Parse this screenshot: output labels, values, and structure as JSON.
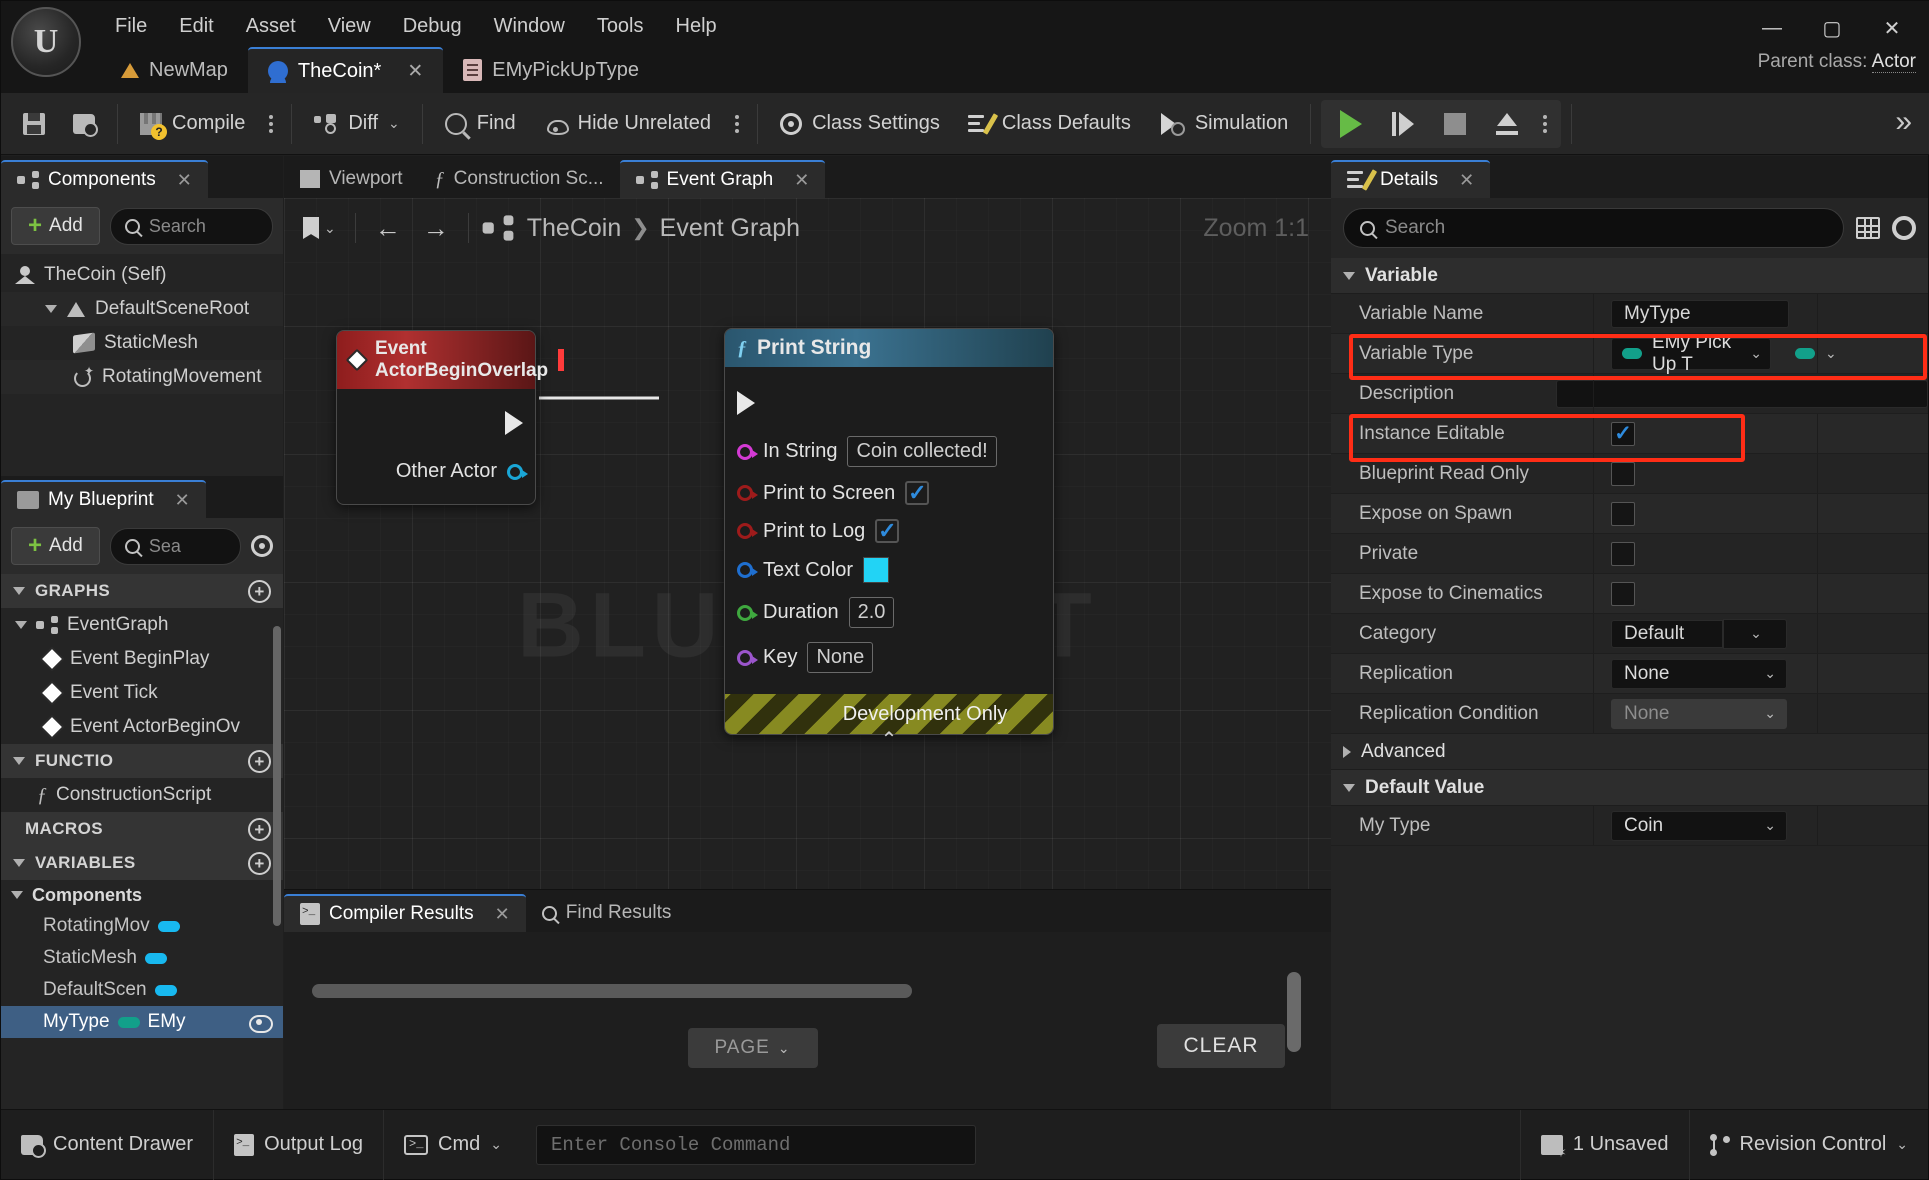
{
  "window": {
    "minimize": "—",
    "maximize": "▢",
    "close": "✕",
    "parent_class_label": "Parent class:",
    "parent_class_value": "Actor"
  },
  "menubar": [
    "File",
    "Edit",
    "Asset",
    "View",
    "Debug",
    "Window",
    "Tools",
    "Help"
  ],
  "asset_tabs": [
    {
      "label": "NewMap",
      "icon": "map-icon",
      "active": false,
      "closable": false
    },
    {
      "label": "TheCoin*",
      "icon": "blueprint-icon",
      "active": true,
      "closable": true,
      "close": "✕"
    },
    {
      "label": "EMyPickUpType",
      "icon": "enum-icon",
      "active": false,
      "closable": false
    }
  ],
  "toolbar": {
    "save": "Save",
    "browse": "Browse",
    "compile": "Compile",
    "diff": "Diff",
    "find": "Find",
    "hide_unrelated": "Hide Unrelated",
    "class_settings": "Class Settings",
    "class_defaults": "Class Defaults",
    "simulation": "Simulation",
    "play": "Play",
    "step": "Step",
    "stop": "Stop",
    "eject": "Eject",
    "expand": "»"
  },
  "components_panel": {
    "tab_label": "Components",
    "tab_close": "✕",
    "add_label": "Add",
    "add_plus": "+",
    "search_placeholder": "Search",
    "tree": [
      {
        "label": "TheCoin (Self)",
        "icon": "actor-icon",
        "indent": 0,
        "expander": "none"
      },
      {
        "label": "DefaultSceneRoot",
        "icon": "scene-root-icon",
        "indent": 1,
        "expander": "down"
      },
      {
        "label": "StaticMesh",
        "icon": "static-mesh-icon",
        "indent": 2,
        "expander": "none"
      },
      {
        "label": "RotatingMovement",
        "icon": "rotating-movement-icon",
        "indent": 2,
        "expander": "none"
      }
    ]
  },
  "my_blueprint_panel": {
    "tab_label": "My Blueprint",
    "tab_close": "✕",
    "add_label": "Add",
    "add_plus": "+",
    "search_placeholder": "Sea",
    "sections": [
      {
        "title": "GRAPHS",
        "add": "+",
        "items": [
          {
            "label": "EventGraph",
            "icon": "graph-icon",
            "indent": 1,
            "expander": "down"
          },
          {
            "label": "Event BeginPlay",
            "icon": "event-node-icon",
            "indent": 2,
            "expander": "none"
          },
          {
            "label": "Event Tick",
            "icon": "event-node-icon",
            "indent": 2,
            "expander": "none"
          },
          {
            "label": "Event ActorBeginOv",
            "icon": "event-node-icon",
            "indent": 2,
            "expander": "none"
          }
        ]
      },
      {
        "title": "FUNCTIO",
        "add": "+",
        "items": [
          {
            "label": "ConstructionScript",
            "icon": "function-icon",
            "indent": 2,
            "expander": "none"
          }
        ]
      },
      {
        "title": "MACROS",
        "add": "+",
        "items": []
      },
      {
        "title": "VARIABLES",
        "add": "+",
        "items": []
      }
    ],
    "variables_group": "Components",
    "variables": [
      {
        "name": "RotatingMov",
        "pill": "blue",
        "type": "",
        "selected": false
      },
      {
        "name": "StaticMesh",
        "pill": "blue",
        "type": "",
        "selected": false
      },
      {
        "name": "DefaultScen",
        "pill": "blue",
        "type": "",
        "selected": false
      },
      {
        "name": "MyType",
        "pill": "green",
        "type": "EMy",
        "selected": true
      }
    ]
  },
  "graph_panel": {
    "tabs": [
      {
        "label": "Viewport",
        "icon": "viewport-icon",
        "active": false
      },
      {
        "label": "Construction Sc...",
        "icon": "function-icon",
        "active": false
      },
      {
        "label": "Event Graph",
        "icon": "graph-icon",
        "active": true,
        "close": "✕"
      }
    ],
    "nav": {
      "back": "←",
      "forward": "→",
      "bookmark_chevron": "⌄"
    },
    "breadcrumb": [
      "TheCoin",
      "Event Graph"
    ],
    "breadcrumb_sep": "❯",
    "zoom": "Zoom 1:1",
    "watermark": "BLUEPRINT",
    "nodes": [
      {
        "id": "event-actor-begin-overlap",
        "title": "Event ActorBeginOverlap",
        "kind": "event",
        "pins": [
          {
            "label": "",
            "type": "exec-out"
          },
          {
            "label": "Other Actor",
            "type": "object-out"
          }
        ]
      },
      {
        "id": "print-string",
        "title": "Print String",
        "kind": "function",
        "pins": [
          {
            "label": "",
            "type": "exec-in"
          },
          {
            "label": "In String",
            "type": "string",
            "value": "Coin collected!"
          },
          {
            "label": "Print to Screen",
            "type": "bool",
            "value": true,
            "check": "✓"
          },
          {
            "label": "Print to Log",
            "type": "bool",
            "value": true,
            "check": "✓"
          },
          {
            "label": "Text Color",
            "type": "color",
            "value": "#22d3f5"
          },
          {
            "label": "Duration",
            "type": "float",
            "value": "2.0"
          },
          {
            "label": "Key",
            "type": "name",
            "value": "None"
          }
        ],
        "footer": "Development Only",
        "collapse": "⌃"
      }
    ]
  },
  "compiler_panel": {
    "tabs": [
      {
        "label": "Compiler Results",
        "icon": "log-icon",
        "active": true,
        "close": "✕"
      },
      {
        "label": "Find Results",
        "icon": "search-icon",
        "active": false
      }
    ],
    "page_label": "PAGE",
    "page_chevron": "⌄",
    "clear_label": "CLEAR"
  },
  "details_panel": {
    "tab_label": "Details",
    "tab_close": "✕",
    "search_placeholder": "Search",
    "categories": [
      {
        "title": "Variable",
        "expander": "down"
      },
      {
        "title": "Default Value",
        "expander": "down"
      }
    ],
    "variable_rows": [
      {
        "label": "Variable Name",
        "control": "text",
        "value": "MyType",
        "highlight": false
      },
      {
        "label": "Variable Type",
        "control": "type",
        "value": "EMy Pick Up T",
        "chevron": "⌄",
        "secondary_chevron": "⌄",
        "highlight": true
      },
      {
        "label": "Description",
        "control": "wide-text",
        "value": "",
        "highlight": false
      },
      {
        "label": "Instance Editable",
        "control": "checkbox",
        "value": true,
        "check": "✓",
        "highlight": true
      },
      {
        "label": "Blueprint Read Only",
        "control": "checkbox",
        "value": false,
        "highlight": false
      },
      {
        "label": "Expose on Spawn",
        "control": "checkbox",
        "value": false,
        "highlight": false
      },
      {
        "label": "Private",
        "control": "checkbox",
        "value": false,
        "highlight": false
      },
      {
        "label": "Expose to Cinematics",
        "control": "checkbox",
        "value": false,
        "highlight": false
      },
      {
        "label": "Category",
        "control": "combo-split",
        "value": "Default",
        "chevron": "⌄",
        "highlight": false
      },
      {
        "label": "Replication",
        "control": "dropdown",
        "value": "None",
        "chevron": "⌄",
        "highlight": false
      },
      {
        "label": "Replication Condition",
        "control": "dropdown-disabled",
        "value": "None",
        "chevron": "⌄",
        "highlight": false
      }
    ],
    "advanced": {
      "title": "Advanced",
      "expander": "right"
    },
    "default_value_rows": [
      {
        "label": "My Type",
        "control": "dropdown",
        "value": "Coin",
        "chevron": "⌄"
      }
    ],
    "highlight_color": "#ff2d16"
  },
  "statusbar": {
    "content_drawer": "Content Drawer",
    "output_log": "Output Log",
    "cmd": "Cmd",
    "cmd_chevron": "⌄",
    "console_placeholder": "Enter Console Command",
    "unsaved": "1 Unsaved",
    "revision_control": "Revision Control",
    "revision_chevron": "⌄"
  }
}
